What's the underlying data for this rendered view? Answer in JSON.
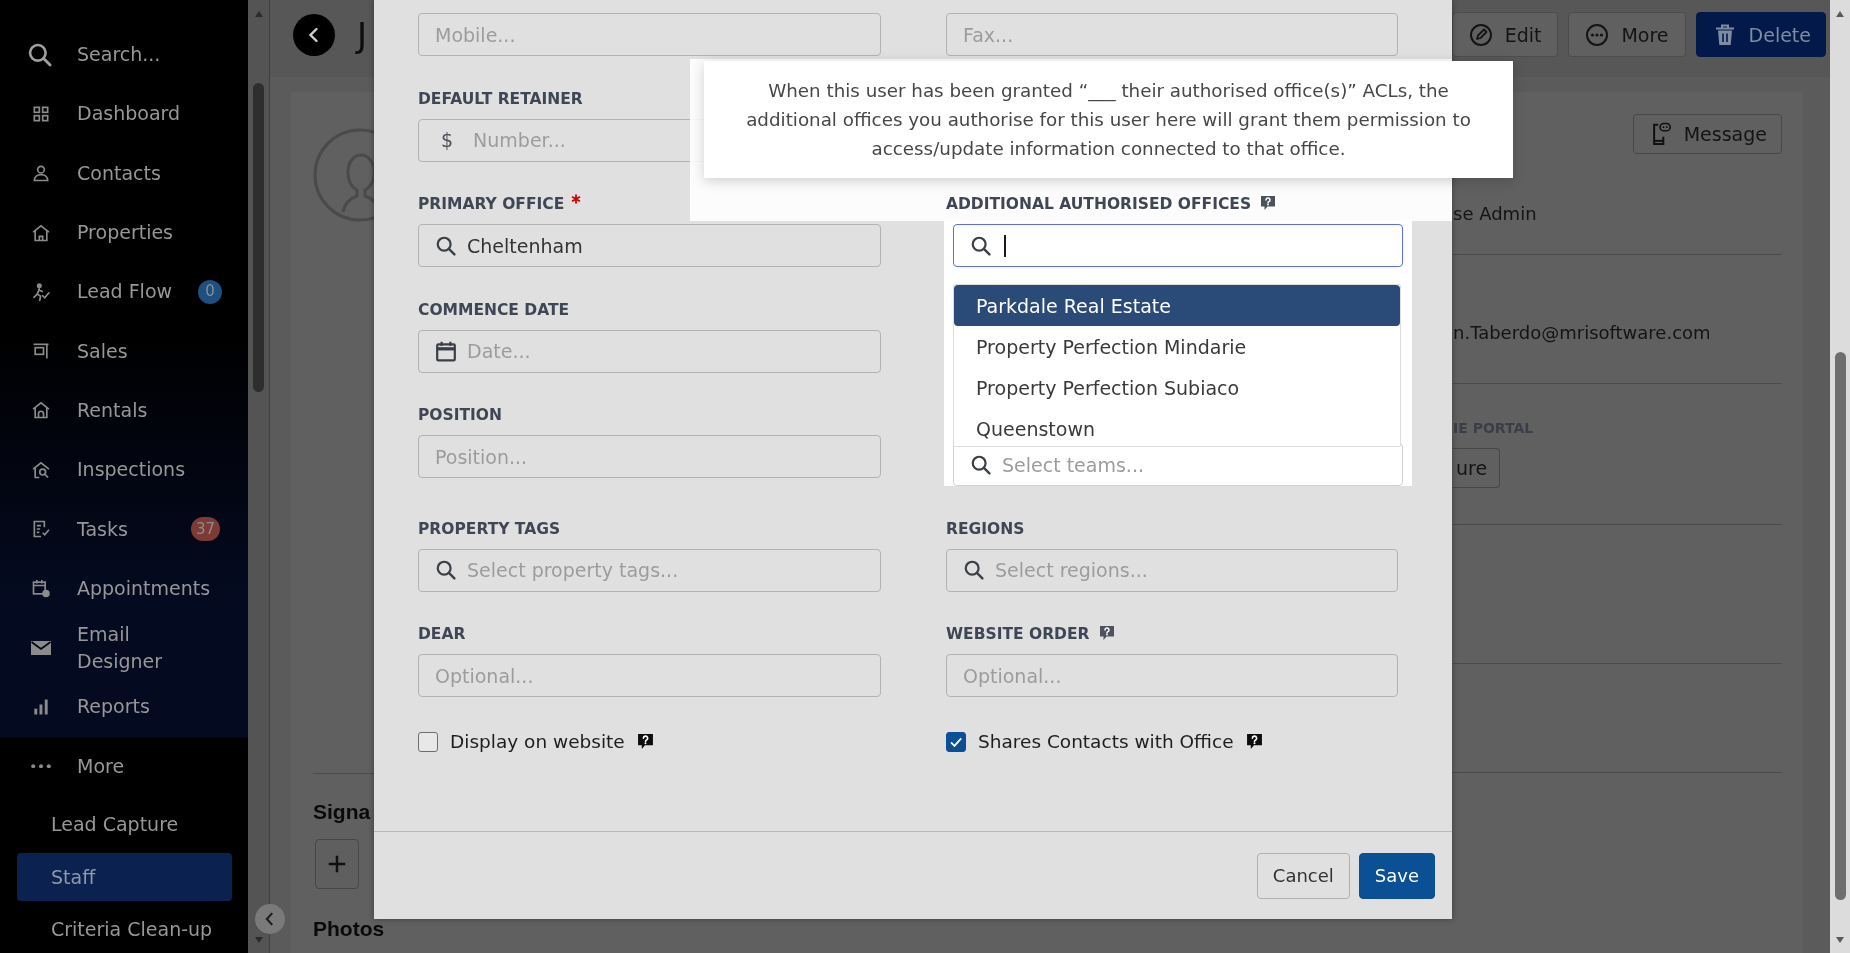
{
  "sidebar": {
    "search": {
      "label": "Search..."
    },
    "items": [
      {
        "label": "Dashboard",
        "selected": false
      },
      {
        "label": "Contacts",
        "selected": false
      },
      {
        "label": "Properties",
        "selected": false
      },
      {
        "label": "Lead Flow",
        "selected": false,
        "badge": {
          "text": "0",
          "color": "#1d4f80"
        }
      },
      {
        "label": "Sales",
        "selected": false
      },
      {
        "label": "Rentals",
        "selected": false
      },
      {
        "label": "Inspections",
        "selected": false
      },
      {
        "label": "Tasks",
        "selected": false,
        "badge": {
          "text": "37",
          "color": "#7c3b37"
        }
      },
      {
        "label": "Appointments",
        "selected": false
      },
      {
        "label": "Email Designer",
        "selected": false
      },
      {
        "label": "Reports",
        "selected": false
      },
      {
        "label": "More",
        "selected": false,
        "children": [
          {
            "label": "Lead Capture",
            "selected": false
          },
          {
            "label": "Staff",
            "selected": true
          },
          {
            "label": "Criteria Clean-up",
            "selected": false
          }
        ]
      }
    ]
  },
  "page": {
    "title": "J",
    "actions": [
      {
        "label": "Edit",
        "kind": "edit"
      },
      {
        "label": "More",
        "kind": "more"
      },
      {
        "label": "Delete",
        "kind": "delete"
      }
    ],
    "message_button": {
      "label": "Message"
    },
    "details": [
      {
        "kind": "value",
        "text": "se Admin"
      },
      {
        "kind": "value",
        "text": "n.Taberdo@mrisoftware.com"
      },
      {
        "kind": "heading",
        "text": "IE PORTAL"
      },
      {
        "kind": "button",
        "text": "ure"
      }
    ],
    "sections": [
      {
        "title": "Signa",
        "add_button": true
      },
      {
        "title": "Photos",
        "add_button": false
      }
    ]
  },
  "dialog": {
    "tooltip": {
      "lines": [
        "When this user has been granted “___ their authorised office(s)” ACLs, the",
        "additional offices you authorise for this user here will grant them permission to",
        "access/update information connected to that office."
      ]
    },
    "left_fields": [
      {
        "kind": "text",
        "placeholder": "Mobile...",
        "focused": false
      },
      {
        "kind": "prefixed",
        "label": "DEFAULT RETAINER",
        "required": false,
        "help": false,
        "prefix": "$",
        "placeholder": "Number...",
        "focused": false
      },
      {
        "kind": "search",
        "label": "PRIMARY OFFICE",
        "required": true,
        "help": false,
        "value": "Cheltenham",
        "focused": false
      },
      {
        "kind": "date",
        "label": "COMMENCE DATE",
        "required": false,
        "help": false,
        "placeholder": "Date...",
        "focused": false
      },
      {
        "kind": "text",
        "label": "POSITION",
        "required": false,
        "help": false,
        "placeholder": "Position...",
        "focused": false
      },
      {
        "kind": "search",
        "label": "PROPERTY TAGS",
        "required": false,
        "help": false,
        "placeholder": "Select property tags...",
        "focused": false
      },
      {
        "kind": "text",
        "label": "DEAR",
        "required": false,
        "help": false,
        "placeholder": "Optional...",
        "focused": false
      },
      {
        "kind": "checkbox",
        "label": "Display on website",
        "checked": false,
        "help": true
      }
    ],
    "right_fields": [
      {
        "kind": "text",
        "placeholder": "Fax...",
        "focused": false
      },
      {
        "kind": "search",
        "label": "ADDITIONAL AUTHORISED OFFICES",
        "required": false,
        "help": true,
        "focused": true,
        "options": [
          {
            "label": "Parkdale Real Estate",
            "selected": true
          },
          {
            "label": "Property Perfection Mindarie",
            "selected": false
          },
          {
            "label": "Property Perfection Subiaco",
            "selected": false
          },
          {
            "label": "Queenstown",
            "selected": false
          }
        ]
      },
      {
        "kind": "search",
        "placeholder": "Select teams...",
        "focused": false
      },
      {
        "kind": "search",
        "label": "REGIONS",
        "required": false,
        "help": false,
        "placeholder": "Select regions...",
        "focused": false
      },
      {
        "kind": "text",
        "label": "WEBSITE ORDER",
        "required": false,
        "help": true,
        "placeholder": "Optional...",
        "focused": false
      },
      {
        "kind": "checkbox",
        "label": "Shares Contacts with Office",
        "checked": true,
        "help": true
      }
    ],
    "buttons": [
      {
        "label": "Cancel",
        "kind": "secondary"
      },
      {
        "label": "Save",
        "kind": "primary"
      }
    ]
  }
}
